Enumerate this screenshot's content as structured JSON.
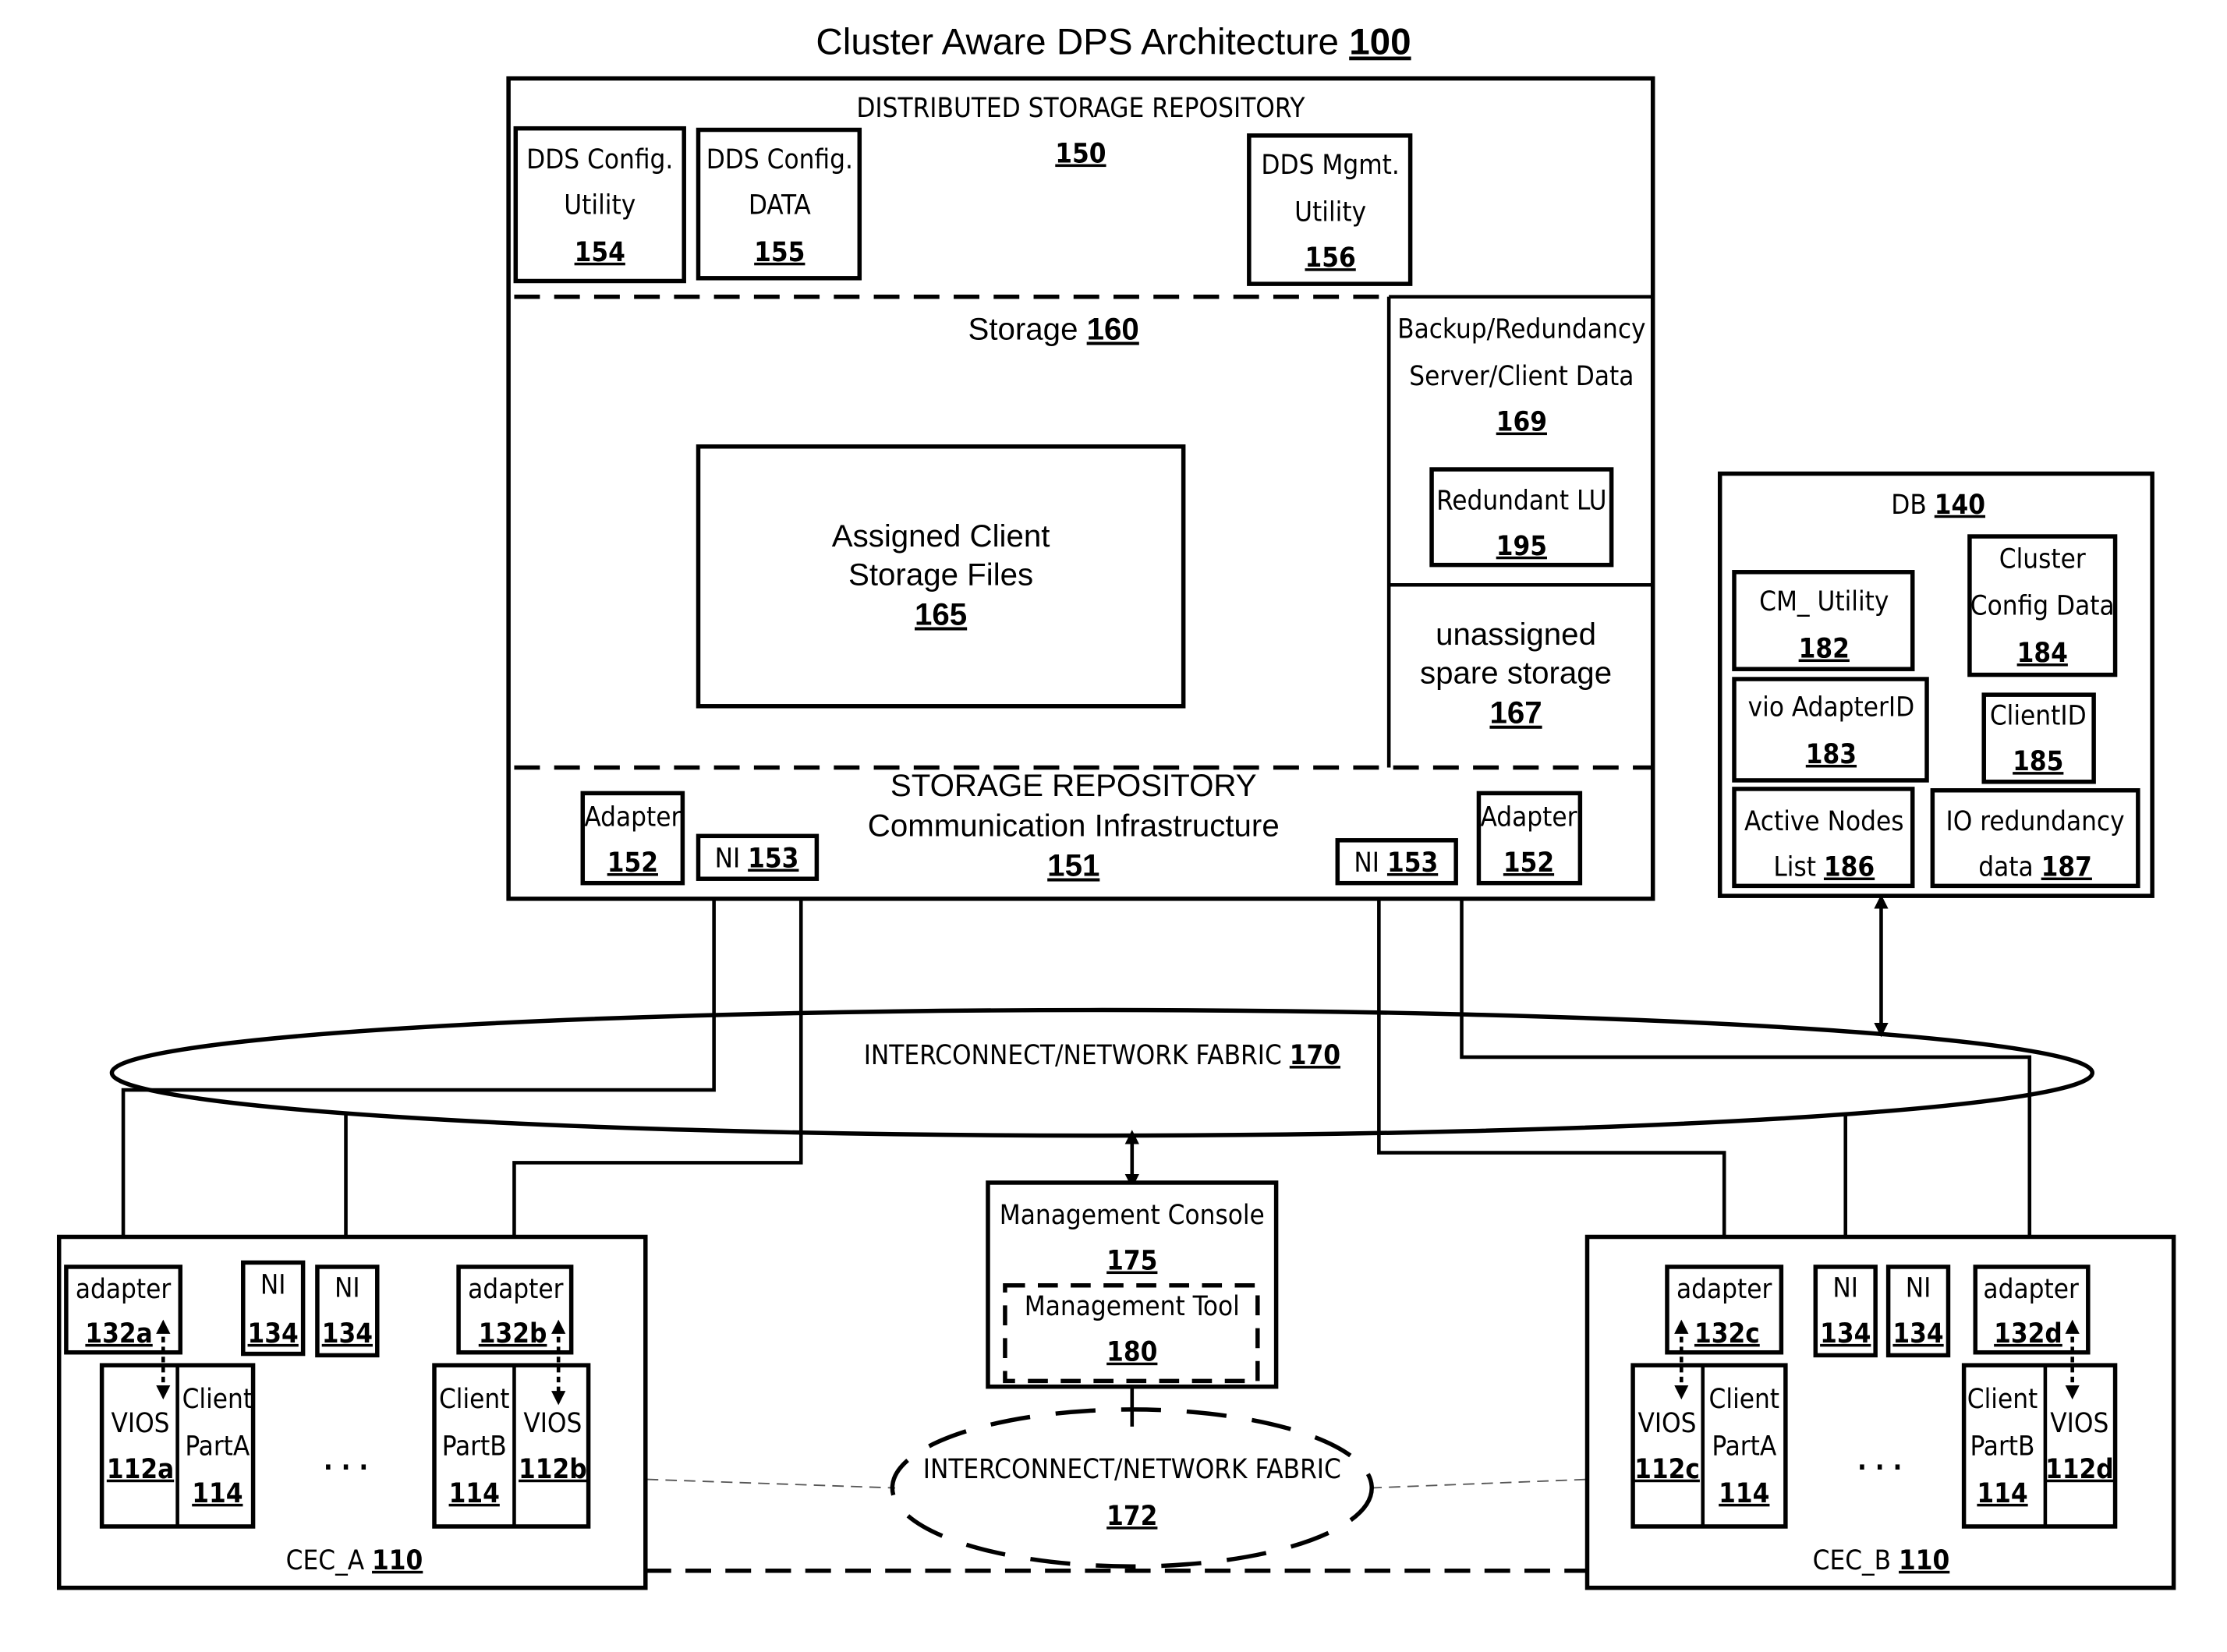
{
  "title": {
    "text": "Cluster Aware DPS Architecture",
    "ref": "100"
  },
  "dsr": {
    "label": "DISTRIBUTED STORAGE REPOSITORY",
    "ref": "150",
    "config_utility": {
      "l1": "DDS Config.",
      "l2": "Utility",
      "ref": "154"
    },
    "config_data": {
      "l1": "DDS Config.",
      "l2": "DATA",
      "ref": "155"
    },
    "mgmt_utility": {
      "l1": "DDS Mgmt.",
      "l2": "Utility",
      "ref": "156"
    },
    "storage": {
      "label": "Storage",
      "ref": "160"
    },
    "assigned": {
      "l1": "Assigned Client",
      "l2": "Storage Files",
      "ref": "165"
    },
    "backup": {
      "l1": "Backup/Redundancy",
      "l2": "Server/Client Data",
      "ref": "169"
    },
    "redundant_lu": {
      "label": "Redundant LU",
      "ref": "195"
    },
    "spare": {
      "l1": "unassigned",
      "l2": "spare storage",
      "ref": "167"
    },
    "comm": {
      "l1": "STORAGE REPOSITORY",
      "l2": "Communication Infrastructure",
      "ref": "151"
    },
    "adapter_left": {
      "label": "Adapter",
      "ref": "152"
    },
    "adapter_right": {
      "label": "Adapter",
      "ref": "152"
    },
    "ni_left": {
      "label": "NI",
      "ref": "153"
    },
    "ni_right": {
      "label": "NI",
      "ref": "153"
    }
  },
  "db": {
    "label": "DB",
    "ref": "140",
    "cm_utility": {
      "label": "CM_ Utility",
      "ref": "182"
    },
    "cluster_config": {
      "l1": "Cluster",
      "l2": "Config Data",
      "ref": "184"
    },
    "vio_adapter": {
      "label": "vio AdapterID",
      "ref": "183"
    },
    "client_id": {
      "label": "ClientID",
      "ref": "185"
    },
    "active_nodes": {
      "l1": "Active Nodes",
      "l2": "List",
      "ref": "186"
    },
    "io_redundancy": {
      "l1": "IO redundancy",
      "l2": "data",
      "ref": "187"
    }
  },
  "fabric": {
    "label": "INTERCONNECT/NETWORK FABRIC",
    "ref": "170"
  },
  "fabric2": {
    "label": "INTERCONNECT/NETWORK FABRIC",
    "ref": "172"
  },
  "console": {
    "label": "Management Console",
    "ref": "175",
    "tool": {
      "label": "Management Tool",
      "ref": "180"
    }
  },
  "cec_a": {
    "label": "CEC_A",
    "ref": "110",
    "adapter1": {
      "label": "adapter",
      "ref": "132a"
    },
    "adapter2": {
      "label": "adapter",
      "ref": "132b"
    },
    "ni": [
      {
        "label": "NI",
        "ref": "134"
      },
      {
        "label": "NI",
        "ref": "134"
      }
    ],
    "vios1": {
      "label": "VIOS",
      "ref": "112a"
    },
    "client1": {
      "l1": "Client",
      "l2": "PartA",
      "ref": "114"
    },
    "client2": {
      "l1": "Client",
      "l2": "PartB",
      "ref": "114"
    },
    "vios2": {
      "label": "VIOS",
      "ref": "112b"
    },
    "ellipsis": ". . ."
  },
  "cec_b": {
    "label": "CEC_B",
    "ref": "110",
    "adapter1": {
      "label": "adapter",
      "ref": "132c"
    },
    "adapter2": {
      "label": "adapter",
      "ref": "132d"
    },
    "ni": [
      {
        "label": "NI",
        "ref": "134"
      },
      {
        "label": "NI",
        "ref": "134"
      }
    ],
    "vios1": {
      "label": "VIOS",
      "ref": "112c"
    },
    "client1": {
      "l1": "Client",
      "l2": "PartA",
      "ref": "114"
    },
    "client2": {
      "l1": "Client",
      "l2": "PartB",
      "ref": "114"
    },
    "vios2": {
      "label": "VIOS",
      "ref": "112d"
    },
    "ellipsis": ". . ."
  }
}
